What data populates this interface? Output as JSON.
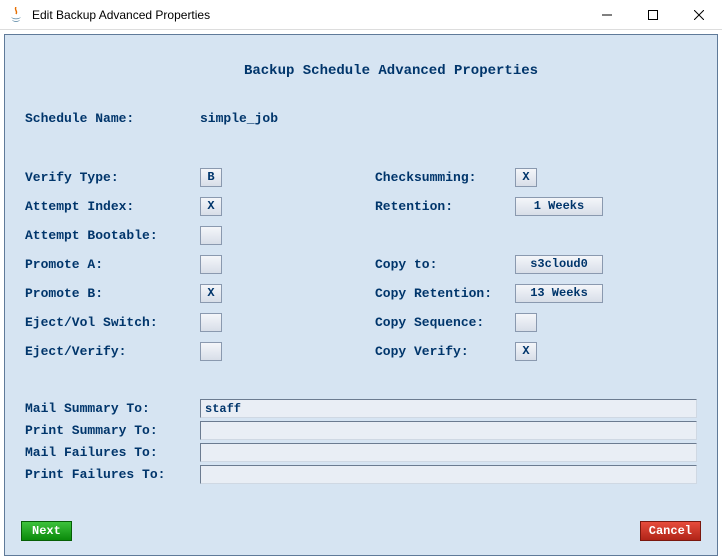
{
  "window": {
    "title": "Edit Backup Advanced Properties"
  },
  "heading": "Backup Schedule Advanced Properties",
  "schedule_name": {
    "label": "Schedule Name:",
    "value": "simple_job"
  },
  "left": {
    "verify_type": {
      "label": "Verify Type:",
      "value": "B"
    },
    "attempt_index": {
      "label": "Attempt Index:",
      "value": "X"
    },
    "attempt_bootable": {
      "label": "Attempt Bootable:",
      "value": ""
    },
    "promote_a": {
      "label": "Promote A:",
      "value": ""
    },
    "promote_b": {
      "label": "Promote B:",
      "value": "X"
    },
    "eject_vol_switch": {
      "label": "Eject/Vol Switch:",
      "value": ""
    },
    "eject_verify": {
      "label": "Eject/Verify:",
      "value": ""
    }
  },
  "right": {
    "checksumming": {
      "label": "Checksumming:",
      "value": "X"
    },
    "retention": {
      "label": "Retention:",
      "value": "1 Weeks"
    },
    "copy_to": {
      "label": "Copy to:",
      "value": "s3cloud0"
    },
    "copy_retention": {
      "label": "Copy Retention:",
      "value": "13 Weeks"
    },
    "copy_sequence": {
      "label": "Copy Sequence:",
      "value": ""
    },
    "copy_verify": {
      "label": "Copy Verify:",
      "value": "X"
    }
  },
  "text_fields": {
    "mail_summary": {
      "label": "Mail Summary To:",
      "value": "staff"
    },
    "print_summary": {
      "label": "Print Summary To:",
      "value": ""
    },
    "mail_failures": {
      "label": "Mail Failures To:",
      "value": ""
    },
    "print_failures": {
      "label": "Print Failures To:",
      "value": ""
    }
  },
  "footer": {
    "next": "Next",
    "cancel": "Cancel"
  }
}
